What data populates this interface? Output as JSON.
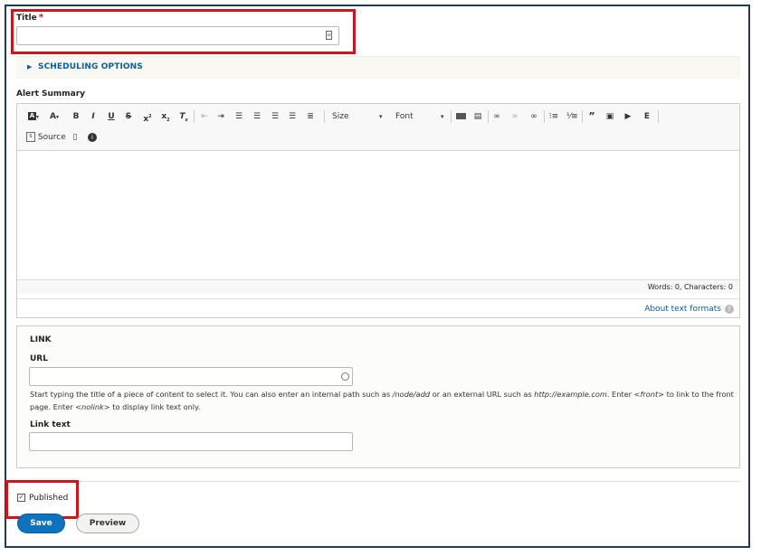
{
  "title_field": {
    "label": "Title",
    "required_marker": "*",
    "value": "",
    "placeholder": ""
  },
  "scheduling": {
    "label": "SCHEDULING OPTIONS"
  },
  "summary": {
    "label": "Alert Summary",
    "toolbar": {
      "size_label": "Size",
      "font_label": "Font",
      "source_label": "Source"
    },
    "wordcount": "Words: 0, Characters: 0",
    "about_link": "About text formats",
    "help_glyph": "?"
  },
  "link": {
    "legend": "LINK",
    "url_label": "URL",
    "url_value": "",
    "help_part1": "Start typing the title of a piece of content to select it. You can also enter an internal path such as ",
    "help_node": "/node/add",
    "help_part2": " or an external URL such as ",
    "help_url": "http://example.com",
    "help_part3": ". Enter ",
    "help_front": "<front>",
    "help_part4": " to link to the front page. Enter ",
    "help_nolink": "<nolink>",
    "help_part5": " to display link text only.",
    "link_text_label": "Link text",
    "link_text_value": ""
  },
  "published": {
    "label": "Published",
    "checked": true
  },
  "actions": {
    "save": "Save",
    "preview": "Preview"
  },
  "colors": {
    "accent": "#0e72be",
    "highlight": "#d0141c",
    "link": "#0c5d9c"
  }
}
